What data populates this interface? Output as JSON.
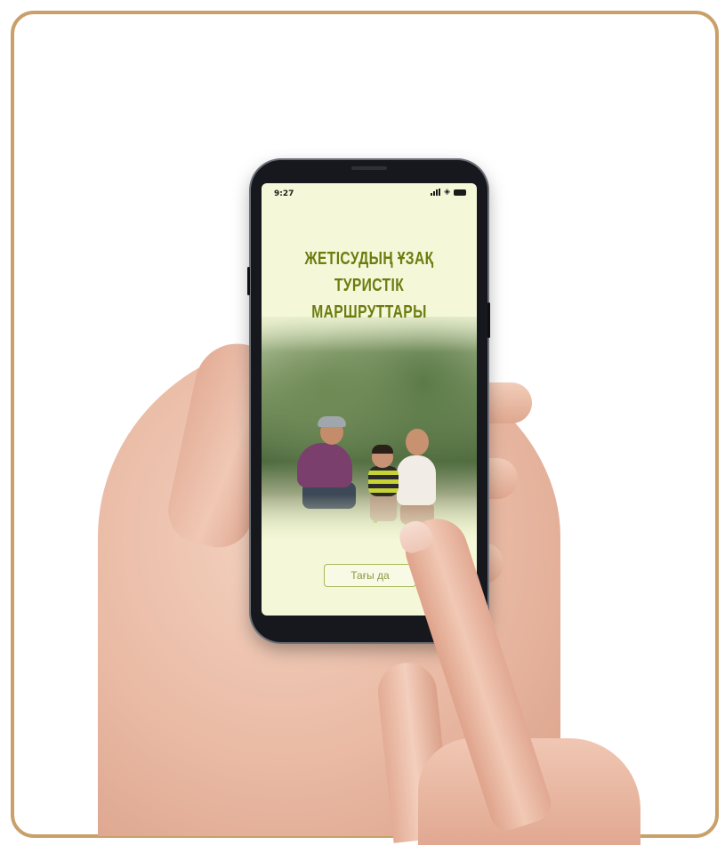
{
  "colors": {
    "frame": "#c9a06a",
    "screen_background": "#f4f8d8",
    "title": "#6b7c10",
    "button_border": "#a7b85a",
    "button_text": "#8a9a45"
  },
  "status_bar": {
    "time": "9:27",
    "icons": [
      "signal-icon",
      "wifi-icon",
      "battery-icon"
    ]
  },
  "screen": {
    "title_line1": "ЖЕТІСУДЫҢ ҰЗАҚ",
    "title_line2": "ТУРИСТІК МАРШРУТТАРЫ",
    "again_button_label": "Тағы да"
  }
}
